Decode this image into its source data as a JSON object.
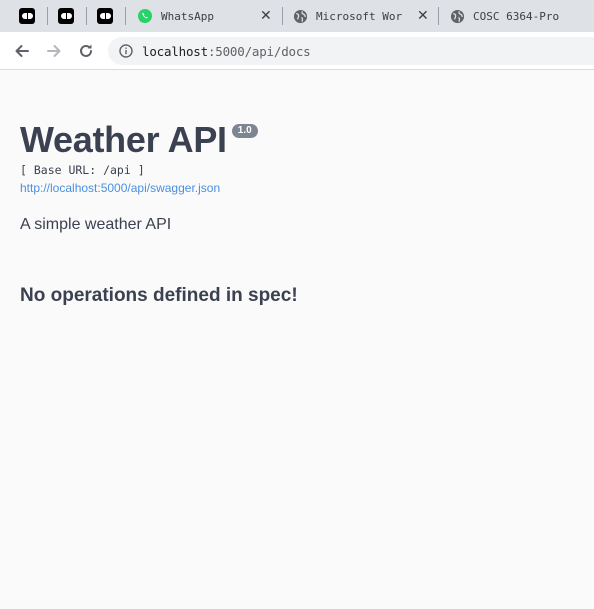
{
  "browser": {
    "tabs": [
      {
        "title": "",
        "favicon": "media-pinned-icon",
        "pinned": true
      },
      {
        "title": "",
        "favicon": "media-pinned-icon",
        "pinned": true
      },
      {
        "title": "",
        "favicon": "media-pinned-icon",
        "pinned": true
      },
      {
        "title": "WhatsApp",
        "favicon": "whatsapp-icon"
      },
      {
        "title": "Microsoft Wor",
        "favicon": "globe-icon"
      },
      {
        "title": "COSC 6364-Pro",
        "favicon": "globe-icon"
      }
    ],
    "close_glyph": "✕",
    "address": {
      "host": "localhost",
      "path": ":5000/api/docs"
    }
  },
  "page": {
    "title": "Weather API",
    "version": "1.0",
    "base_url": "[ Base URL: /api ]",
    "spec_link": "http://localhost:5000/api/swagger.json",
    "description": "A simple weather API",
    "no_operations": "No operations defined in spec!"
  },
  "colors": {
    "title": "#3b4151",
    "link": "#4990e2",
    "badge": "#7d8492",
    "tabstrip": "#dee1e6",
    "whatsapp": "#25d366"
  }
}
